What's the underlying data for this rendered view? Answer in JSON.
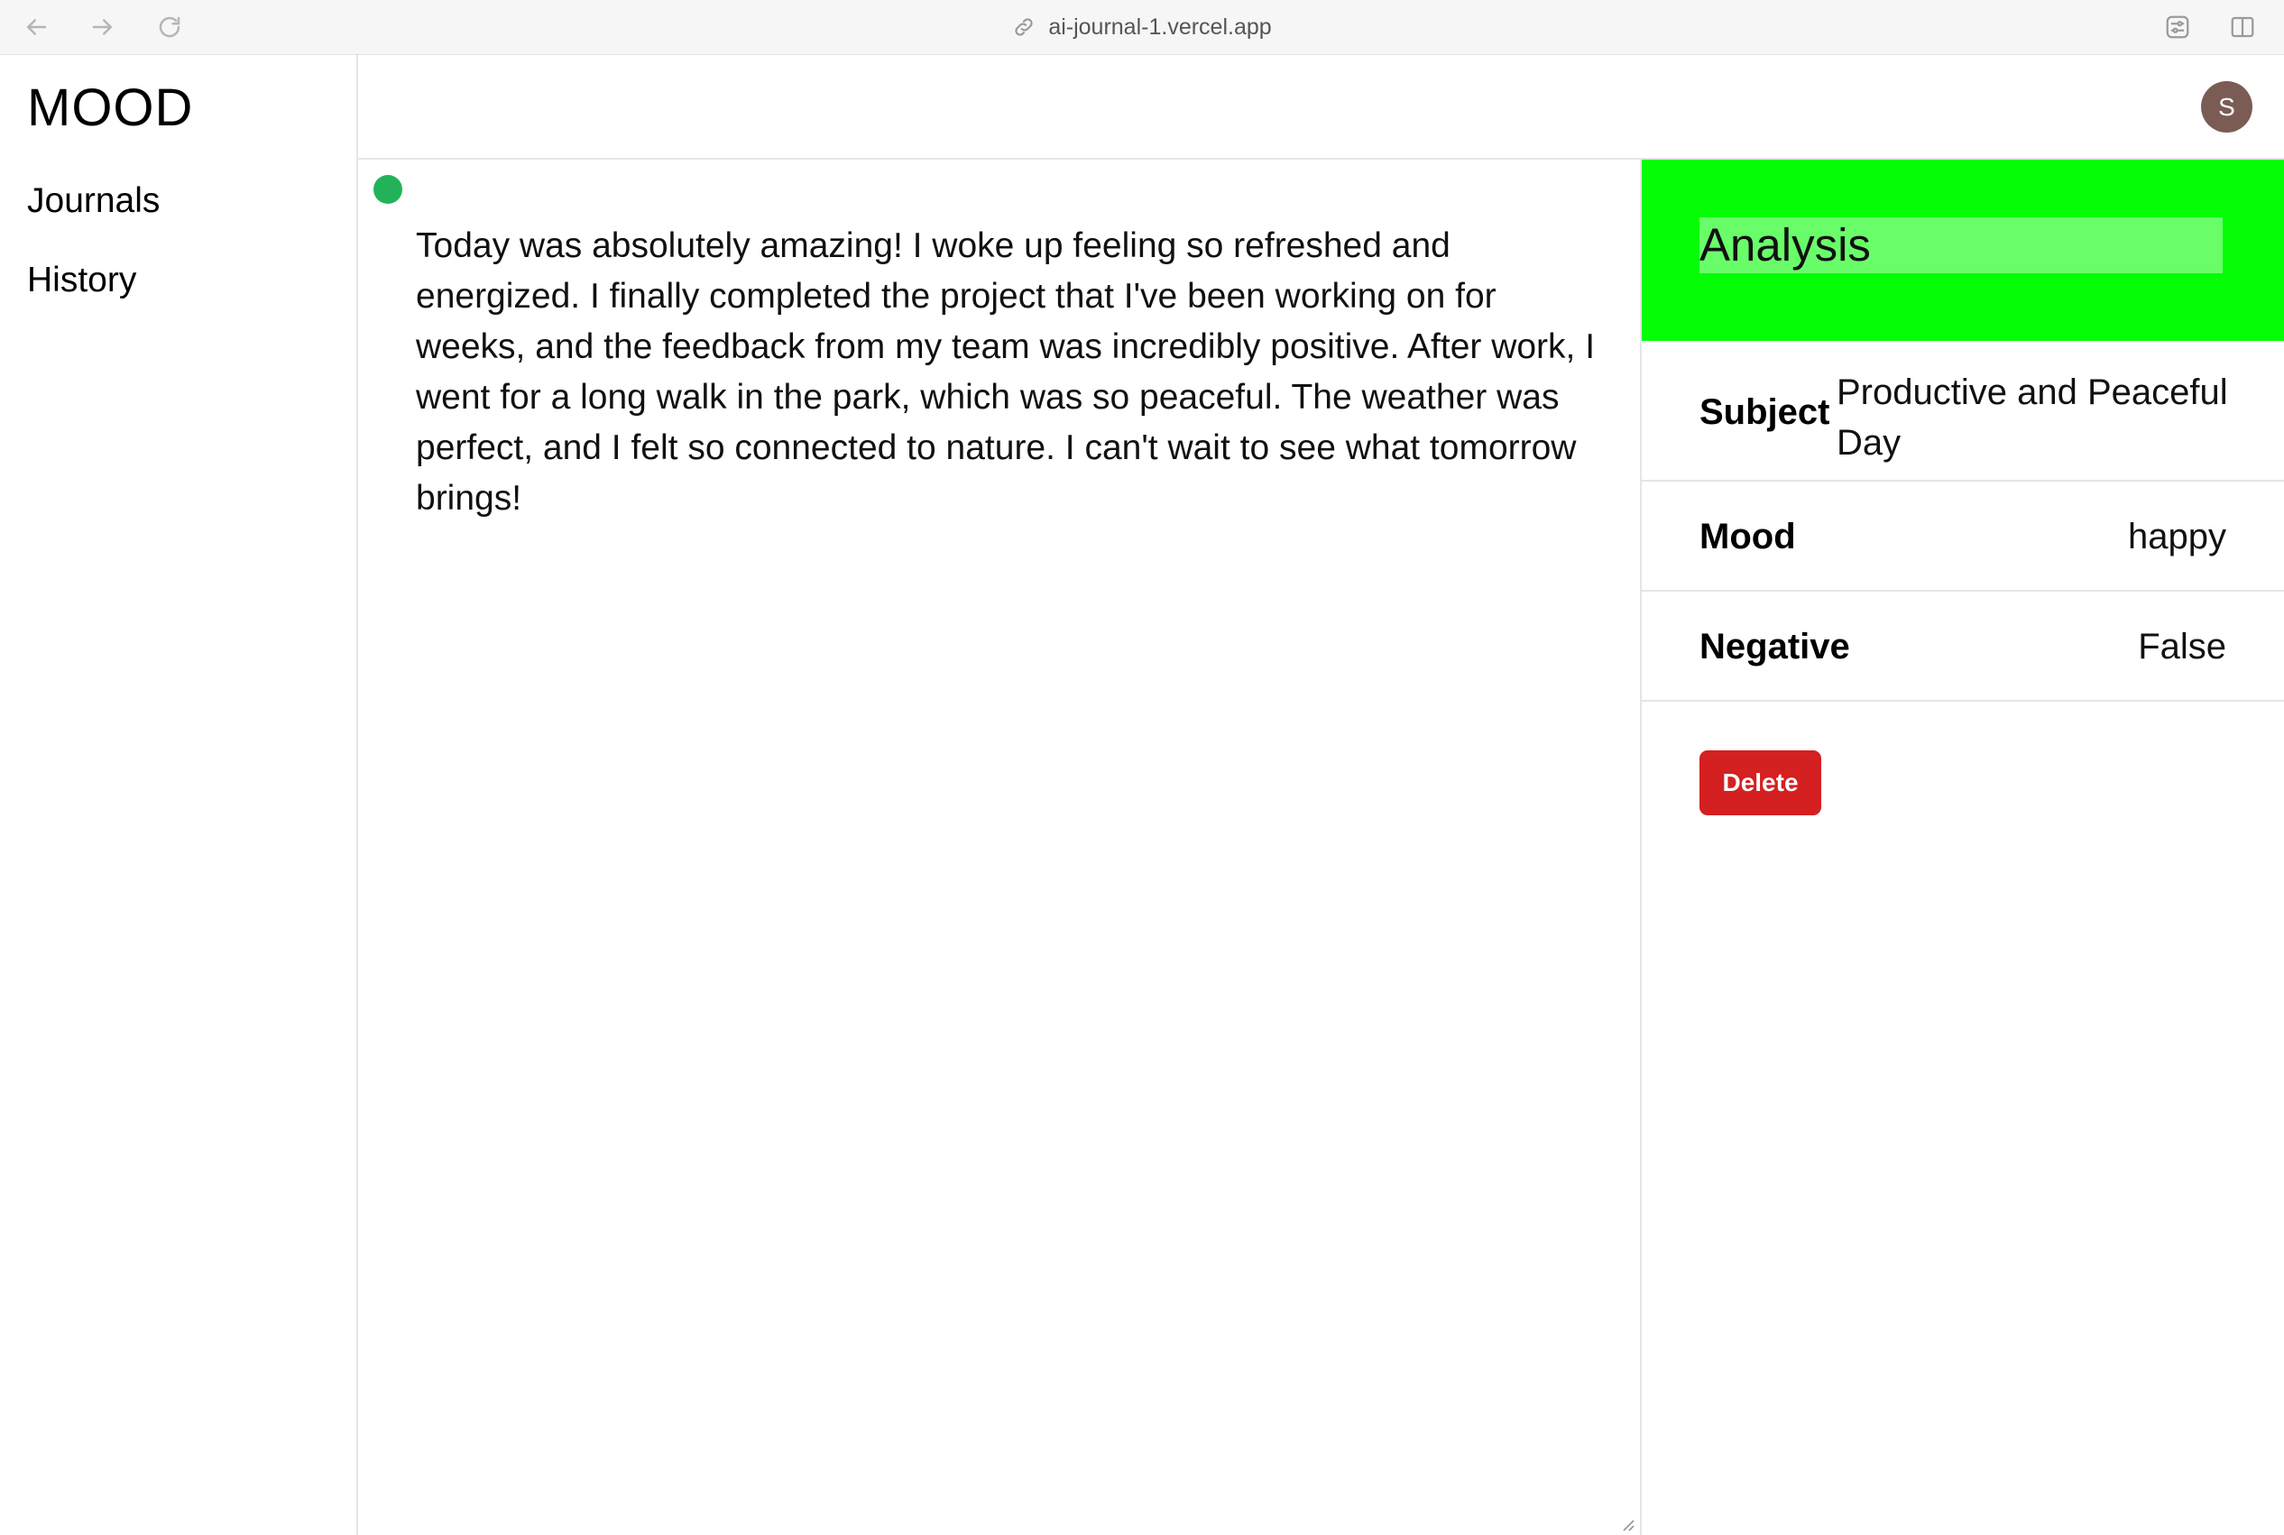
{
  "browser": {
    "url": "ai-journal-1.vercel.app",
    "back_icon": "arrow-left-icon",
    "forward_icon": "arrow-right-icon",
    "reload_icon": "reload-icon"
  },
  "sidebar": {
    "brand": "MOOD",
    "items": [
      {
        "label": "Journals"
      },
      {
        "label": "History"
      }
    ]
  },
  "header": {
    "avatar_initial": "S",
    "avatar_color": "#7a5c55"
  },
  "editor": {
    "status_color": "#22b35a",
    "content": "Today was absolutely amazing! I woke up feeling so refreshed and energized. I finally completed the project that I've been working on for weeks, and the feedback from my team was incredibly positive. After work, I went for a long walk in the park, which was so peaceful. The weather was perfect, and I felt so connected to nature. I can't wait to see what tomorrow brings!"
  },
  "analysis": {
    "title": "Analysis",
    "header_color": "#05fd05",
    "subject_label": "Subject",
    "subject_value": "Productive and Peaceful Day",
    "mood_label": "Mood",
    "mood_value": "happy",
    "negative_label": "Negative",
    "negative_value": "False",
    "delete_label": "Delete",
    "delete_color": "#d42020"
  }
}
